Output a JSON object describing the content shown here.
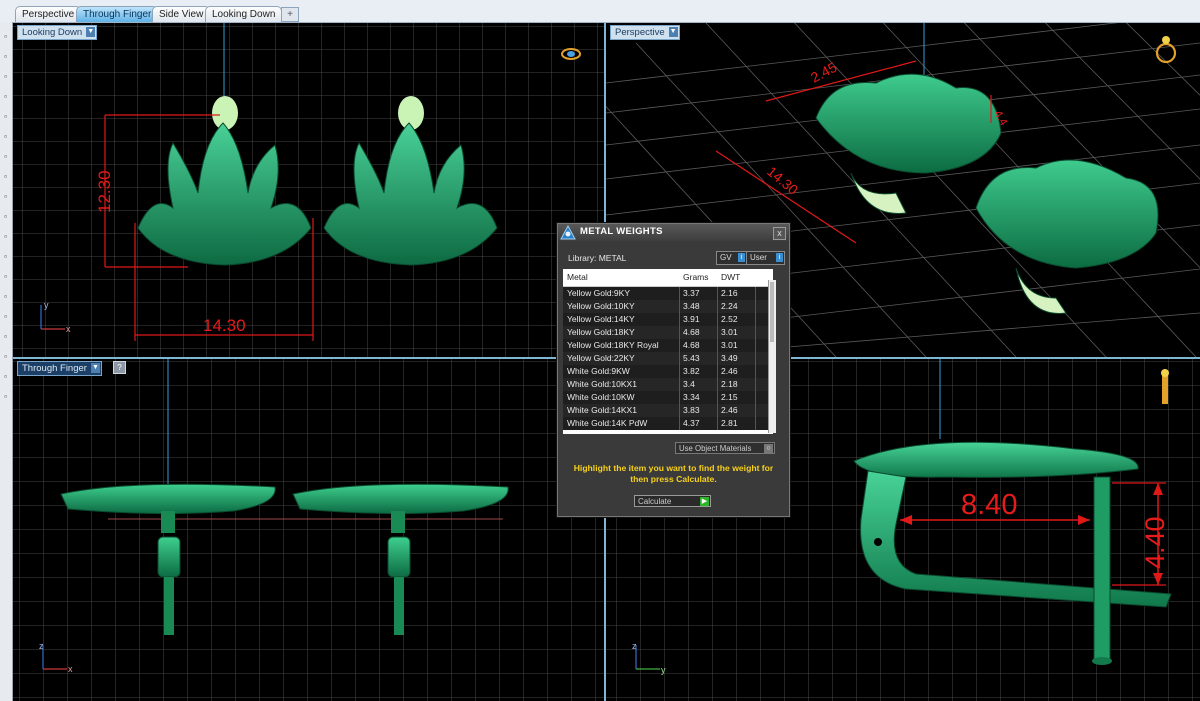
{
  "tabs": [
    "Perspective",
    "Through Finger",
    "Side View",
    "Looking Down"
  ],
  "active_tab": "Through Finger",
  "tab_add": "+",
  "viewports": {
    "top_left": {
      "label": "Looking Down",
      "dim_height": "12.30",
      "dim_width": "14.30",
      "axis_y": "y",
      "axis_x": "x"
    },
    "top_right": {
      "label": "Perspective",
      "dim_a": "2.45",
      "dim_b": "14.30",
      "dim_c": "4.4"
    },
    "bottom_left": {
      "label": "Through Finger",
      "axis_z": "z",
      "axis_x": "x"
    },
    "bottom_right": {
      "dim_width": "8.40",
      "dim_height": "4.40",
      "axis_z": "z",
      "axis_y": "y"
    }
  },
  "dialog": {
    "title": "METAL WEIGHTS",
    "close": "x",
    "library_label": "Library: METAL",
    "gv_label": "GV",
    "user_label": "User",
    "columns": [
      "Metal",
      "Grams",
      "DWT"
    ],
    "rows": [
      {
        "metal": "Yellow Gold:9KY",
        "grams": "3.37",
        "dwt": "2.16"
      },
      {
        "metal": "Yellow Gold:10KY",
        "grams": "3.48",
        "dwt": "2.24"
      },
      {
        "metal": "Yellow Gold:14KY",
        "grams": "3.91",
        "dwt": "2.52"
      },
      {
        "metal": "Yellow Gold:18KY",
        "grams": "4.68",
        "dwt": "3.01"
      },
      {
        "metal": "Yellow Gold:18KY Royal",
        "grams": "4.68",
        "dwt": "3.01"
      },
      {
        "metal": "Yellow Gold:22KY",
        "grams": "5.43",
        "dwt": "3.49"
      },
      {
        "metal": "White Gold:9KW",
        "grams": "3.82",
        "dwt": "2.46"
      },
      {
        "metal": "White Gold:10KX1",
        "grams": "3.4",
        "dwt": "2.18"
      },
      {
        "metal": "White Gold:10KW",
        "grams": "3.34",
        "dwt": "2.15"
      },
      {
        "metal": "White Gold:14KX1",
        "grams": "3.83",
        "dwt": "2.46"
      },
      {
        "metal": "White Gold:14K PdW",
        "grams": "4.37",
        "dwt": "2.81"
      }
    ],
    "use_object_materials": "Use Object Materials",
    "hint": "Highlight the item you want to find the weight for then press Calculate.",
    "calculate": "Calculate"
  },
  "colors": {
    "model_green": "#22a06b",
    "dimension_red": "#e01818",
    "hint_yellow": "#f6d11c",
    "active_tab": "#5fb2e6"
  }
}
